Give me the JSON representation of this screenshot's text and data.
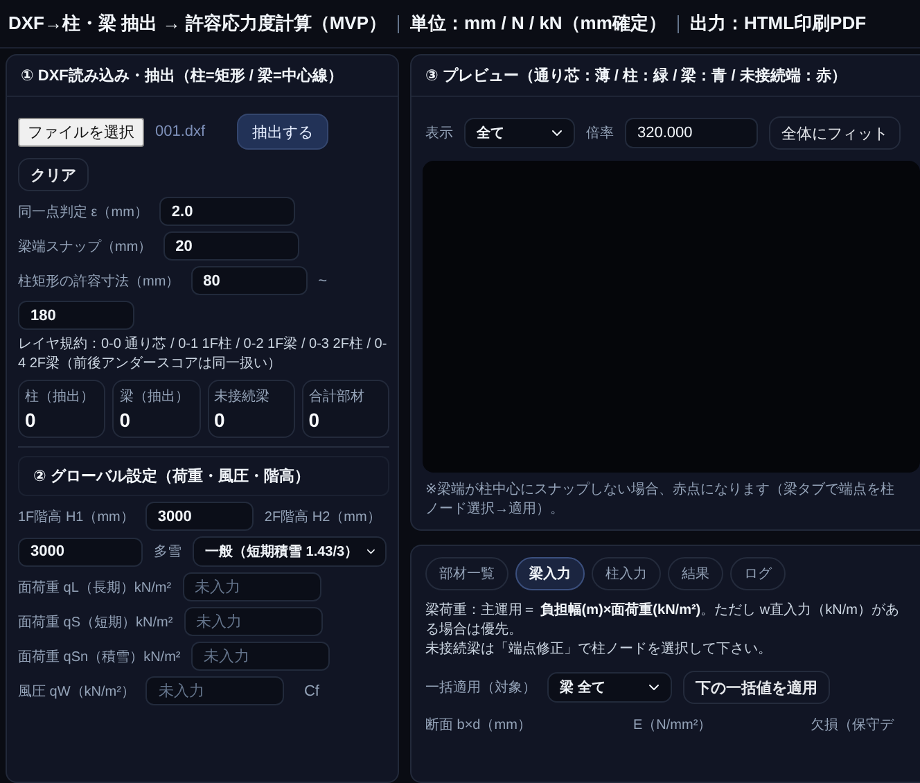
{
  "header": {
    "segments": [
      "DXF→柱・梁 抽出 → 許容応力度計算（MVP）",
      "単位：mm / N / kN（mm確定）",
      "出力：HTML印刷PDF"
    ]
  },
  "extract_panel": {
    "title": "① DXF読み込み・抽出（柱=矩形 / 梁=中心線）",
    "file_button": "ファイルを選択",
    "file_name": "001.dxf",
    "extract_button": "抽出する",
    "clear_button": "クリア",
    "epsilon": {
      "label": "同一点判定 ε（mm）",
      "value": "2.0"
    },
    "snap": {
      "label": "梁端スナップ（mm）",
      "value": "20"
    },
    "column_size": {
      "label": "柱矩形の許容寸法（mm）",
      "min": "80",
      "separator": "~",
      "max": "180"
    },
    "layer_note": "レイヤ規約：0-0 通り芯 / 0-1 1F柱 / 0-2 1F梁 / 0-3 2F柱 / 0-4 2F梁（前後アンダースコアは同一扱い）",
    "stats": [
      {
        "label": "柱（抽出）",
        "value": "0"
      },
      {
        "label": "梁（抽出）",
        "value": "0"
      },
      {
        "label": "未接続梁",
        "value": "0"
      },
      {
        "label": "合計部材",
        "value": "0"
      }
    ]
  },
  "global_panel": {
    "title": "② グローバル設定（荷重・風圧・階高）",
    "h1": {
      "label": "1F階高 H1（mm）",
      "value": "3000"
    },
    "h2": {
      "label": "2F階高 H2（mm）",
      "value": "3000"
    },
    "snow": {
      "label": "多雪",
      "value": "一般（短期積雪 1.43/3）"
    },
    "loads": [
      {
        "label": "面荷重 qL（長期）kN/m²",
        "placeholder": "未入力"
      },
      {
        "label": "面荷重 qS（短期）kN/m²",
        "placeholder": "未入力"
      },
      {
        "label": "面荷重 qSn（積雪）kN/m²",
        "placeholder": "未入力"
      },
      {
        "label": "風圧 qW（kN/m²）",
        "placeholder": "未入力",
        "suffix": "Cf"
      }
    ]
  },
  "preview_panel": {
    "title": "③ プレビュー（通り芯：薄 / 柱：緑 / 梁：青 / 未接続端：赤）",
    "view_label": "表示",
    "view_value": "全て",
    "scale_label": "倍率",
    "scale_value": "320.000",
    "fit_button": "全体にフィット",
    "note": "※梁端が柱中心にスナップしない場合、赤点になります（梁タブで端点を柱ノード選択→適用）。"
  },
  "beam_panel": {
    "tabs": [
      {
        "label": "部材一覧",
        "selected": false
      },
      {
        "label": "梁入力",
        "selected": true
      },
      {
        "label": "柱入力",
        "selected": false
      },
      {
        "label": "結果",
        "selected": false
      },
      {
        "label": "ログ",
        "selected": false
      }
    ],
    "description": [
      "梁荷重：主運用＝ **負担幅(m)×面荷重(kN/m²)**。ただし w直入力（kN/m）がある場合は優先。",
      "未接続梁は「端点修正」で柱ノードを選択して下さい。"
    ],
    "bulk_label": "一括適用（対象）",
    "bulk_target": "梁 全て",
    "bulk_button": "下の一括値を適用",
    "columns": [
      "断面 b×d（mm）",
      "E（N/mm²）",
      "欠損（保守デ"
    ]
  }
}
